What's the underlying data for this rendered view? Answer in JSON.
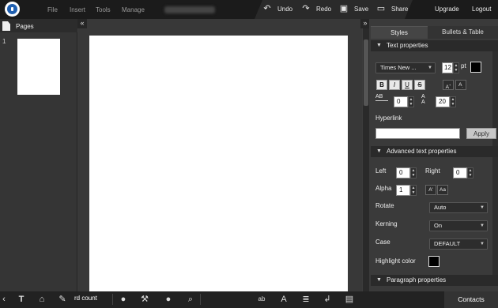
{
  "menu": {
    "file": "File",
    "insert": "Insert",
    "tools": "Tools",
    "manage": "Manage"
  },
  "toolbar": {
    "undo": "Undo",
    "redo": "Redo",
    "save": "Save",
    "share": "Share",
    "upgrade": "Upgrade",
    "logout": "Logout"
  },
  "pages_panel": {
    "title": "Pages",
    "page_number": "1"
  },
  "right_panel": {
    "tabs": [
      "Styles",
      "Bullets & Table"
    ],
    "text_properties": {
      "header": "Text properties",
      "font": "Times New ...",
      "size": "12",
      "size_unit": "pt",
      "bold": "B",
      "italic": "I",
      "underline": "U",
      "strike": "S",
      "superscript": "A",
      "subscript": "A",
      "char_spacing": "0",
      "line_spacing": "20",
      "spacing_label": "AB",
      "hyperlink_label": "Hyperlink",
      "hyperlink_value": "",
      "apply": "Apply"
    },
    "advanced": {
      "header": "Advanced text properties",
      "left_label": "Left",
      "left_value": "0",
      "right_label": "Right",
      "right_value": "0",
      "alpha_label": "Alpha",
      "alpha_value": "1",
      "rotate_label": "Rotate",
      "rotate_value": "Auto",
      "kerning_label": "Kerning",
      "kerning_value": "On",
      "case_label": "Case",
      "case_value": "DEFAULT",
      "highlight_label": "Highlight color"
    },
    "paragraph": {
      "header": "Paragraph properties"
    }
  },
  "bottom": {
    "word_count": "rd count",
    "contacts": "Contacts"
  },
  "colors": {
    "accent": "#1f5fb0",
    "text_color": "#000000",
    "highlight": "#000000"
  }
}
